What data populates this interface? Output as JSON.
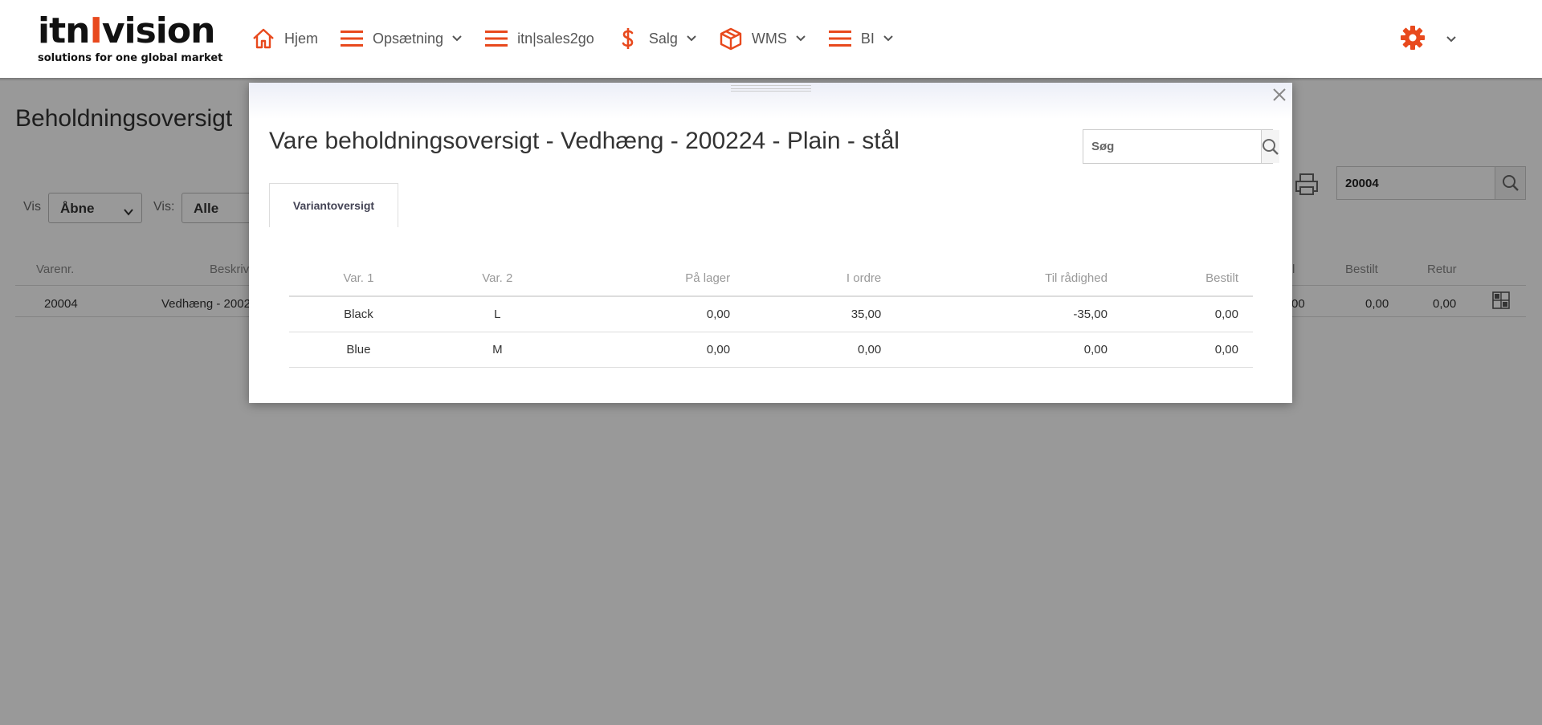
{
  "logo": {
    "brand_left": "itn",
    "brand_bar": "I",
    "brand_right": "vision",
    "tagline": "solutions for one global market"
  },
  "nav": {
    "items": [
      {
        "label": "Hjem",
        "icon": "home-icon"
      },
      {
        "label": "Opsætning",
        "icon": "menu-icon"
      },
      {
        "label": "itn|sales2go",
        "icon": "menu-icon"
      },
      {
        "label": "Salg",
        "icon": "dollar-icon"
      },
      {
        "label": "WMS",
        "icon": "box-icon"
      },
      {
        "label": "BI",
        "icon": "menu-icon"
      }
    ],
    "settings_icon": "gear-icon"
  },
  "colors": {
    "accent": "#e8491d",
    "overlay": "rgba(0,0,0,0.40)"
  },
  "background_page": {
    "title": "Beholdningsoversigt",
    "filter1_label": "Vis",
    "filter1_value": "Åbne",
    "filter2_label": "Vis:",
    "filter2_value": "Alle",
    "search_value": "20004",
    "columns": {
      "varenr": "Varenr.",
      "beskrivelse": "Beskriv",
      "partial": "l",
      "bestilt": "Bestilt",
      "retur": "Retur"
    },
    "row": {
      "varenr": "20004",
      "beskrivelse": "Vedhæng - 2002",
      "partial": "00",
      "bestilt": "0,00",
      "retur": "0,00"
    }
  },
  "modal": {
    "title": "Vare beholdningsoversigt - Vedhæng - 200224 - Plain - stål",
    "search_placeholder": "Søg",
    "tab_label": "Variantoversigt",
    "columns": [
      "Var. 1",
      "Var. 2",
      "På lager",
      "I ordre",
      "Til rådighed",
      "Bestilt"
    ],
    "rows": [
      [
        "Black",
        "L",
        "0,00",
        "35,00",
        "-35,00",
        "0,00"
      ],
      [
        "Blue",
        "M",
        "0,00",
        "0,00",
        "0,00",
        "0,00"
      ]
    ]
  }
}
